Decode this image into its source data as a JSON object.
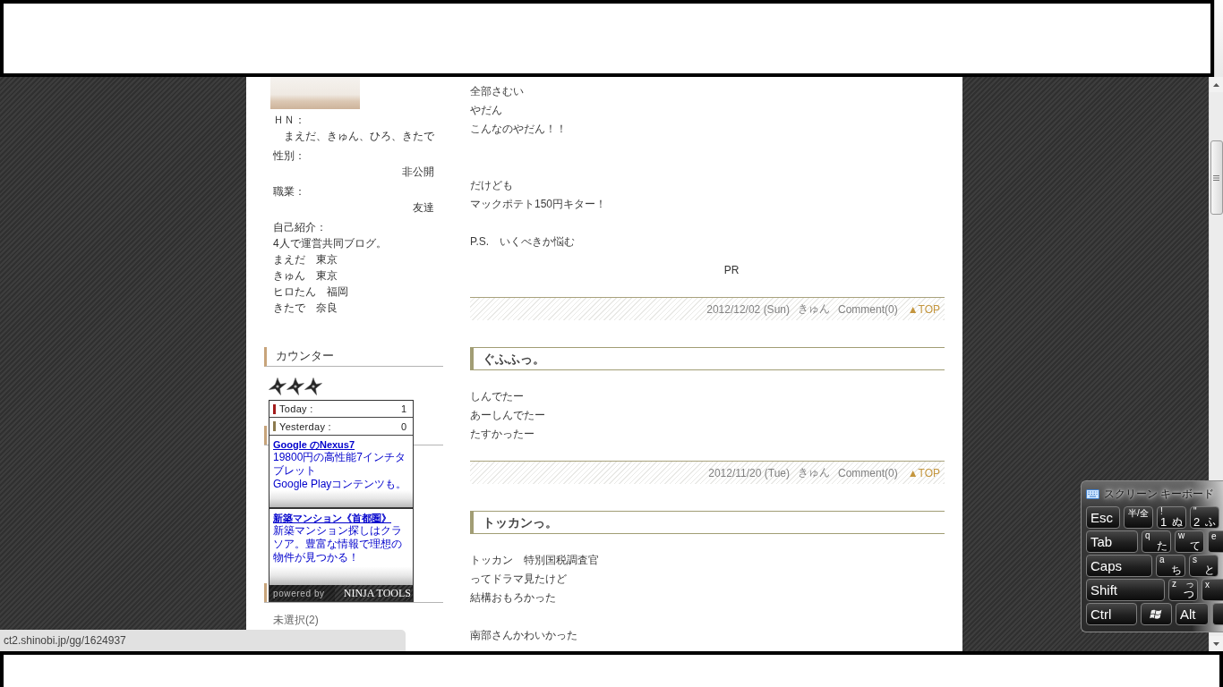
{
  "status_bar": {
    "url": "ct2.shinobi.jp/gg/1624937"
  },
  "sidebar": {
    "profile": {
      "fields": [
        {
          "label": "ＨＮ：",
          "value": "まえだ、きゅん、ひろ、きたで"
        },
        {
          "label": "性別：",
          "value": "非公開"
        },
        {
          "label": "職業：",
          "value": "友達"
        }
      ],
      "introduction": {
        "label": "自己紹介：",
        "lines": [
          "4人で運営共同ブログ。",
          "まえだ　東京",
          "きゅん　東京",
          "ヒロたん　福岡",
          "きたで　奈良"
        ]
      }
    },
    "counter": {
      "title": "カウンター",
      "popup": {
        "rows": [
          {
            "label": "Today :",
            "value": "1",
            "color": "#a31c1c"
          },
          {
            "label": "Yesterday :",
            "value": "0",
            "color": "#8c7a4e"
          }
        ],
        "ads": [
          {
            "title": "Google のNexus7",
            "lines": [
              "19800円の高性能7インチタブレット",
              "Google Playコンテンツも。"
            ]
          },
          {
            "title": "新築マンション《首都圏》",
            "lines": [
              "新築マンション探しはクラソア。豊富な情報で理想の物件が見つかる！"
            ]
          }
        ],
        "footer": {
          "powered_by": "powered by",
          "brand": "NINJA TOOLS"
        }
      }
    },
    "categories": [
      "未選択(2)"
    ]
  },
  "posts": [
    {
      "body": [
        {
          "kind": "line",
          "text": "全部さむい"
        },
        {
          "kind": "line",
          "text": "やだん"
        },
        {
          "kind": "line",
          "text": "こんなのやだん！！"
        },
        {
          "kind": "blank"
        },
        {
          "kind": "blank"
        },
        {
          "kind": "line",
          "text": "だけども"
        },
        {
          "kind": "line",
          "text": "マックポテト150円キター！"
        },
        {
          "kind": "blank"
        },
        {
          "kind": "line",
          "text": "P.S.　いくべきか悩む"
        }
      ],
      "pr": "PR",
      "footer": {
        "date": "2012/12/02 (Sun)",
        "author": "きゅん",
        "comments": "Comment(0)",
        "top": "▲TOP"
      }
    },
    {
      "title": "ぐふふっ。",
      "body": [
        {
          "kind": "line",
          "text": "しんでたー"
        },
        {
          "kind": "line",
          "text": "あーしんでたー"
        },
        {
          "kind": "line",
          "text": "たすかったー"
        }
      ],
      "footer": {
        "date": "2012/11/20 (Tue)",
        "author": "きゅん",
        "comments": "Comment(0)",
        "top": "▲TOP"
      }
    },
    {
      "title": "トッカンっ。",
      "body": [
        {
          "kind": "line",
          "text": "トッカン　特別国税調査官"
        },
        {
          "kind": "line",
          "text": "ってドラマ見たけど"
        },
        {
          "kind": "line",
          "text": "結構おもろかった"
        },
        {
          "kind": "blank"
        },
        {
          "kind": "line",
          "text": "南部さんかわいかった"
        }
      ]
    }
  ],
  "onscreen_keyboard": {
    "title": "スクリーン キーボード",
    "rows": [
      [
        {
          "kind": "label",
          "label": "Esc"
        },
        {
          "kind": "small",
          "label": "半/全"
        },
        {
          "kind": "char",
          "top": "!",
          "main": "1",
          "kana": "ぬ"
        },
        {
          "kind": "char",
          "top": "\"",
          "main": "2",
          "kana": "ふ"
        }
      ],
      [
        {
          "kind": "label",
          "label": "Tab"
        },
        {
          "kind": "char",
          "top": "q",
          "kana": "た"
        },
        {
          "kind": "char",
          "top": "w",
          "kana": "て"
        },
        {
          "kind": "partial",
          "top": "e"
        }
      ],
      [
        {
          "kind": "label",
          "label": "Caps"
        },
        {
          "kind": "char",
          "top": "a",
          "kana": "ち"
        },
        {
          "kind": "char",
          "top": "s",
          "kana": "と"
        }
      ],
      [
        {
          "kind": "label",
          "label": "Shift"
        },
        {
          "kind": "char",
          "top": "z",
          "kana_top": "っ",
          "kana": "つ"
        },
        {
          "kind": "partial",
          "top": "x"
        }
      ],
      [
        {
          "kind": "label",
          "label": "Ctrl"
        },
        {
          "kind": "logo"
        },
        {
          "kind": "label",
          "label": "Alt"
        },
        {
          "kind": "partial"
        }
      ]
    ]
  }
}
